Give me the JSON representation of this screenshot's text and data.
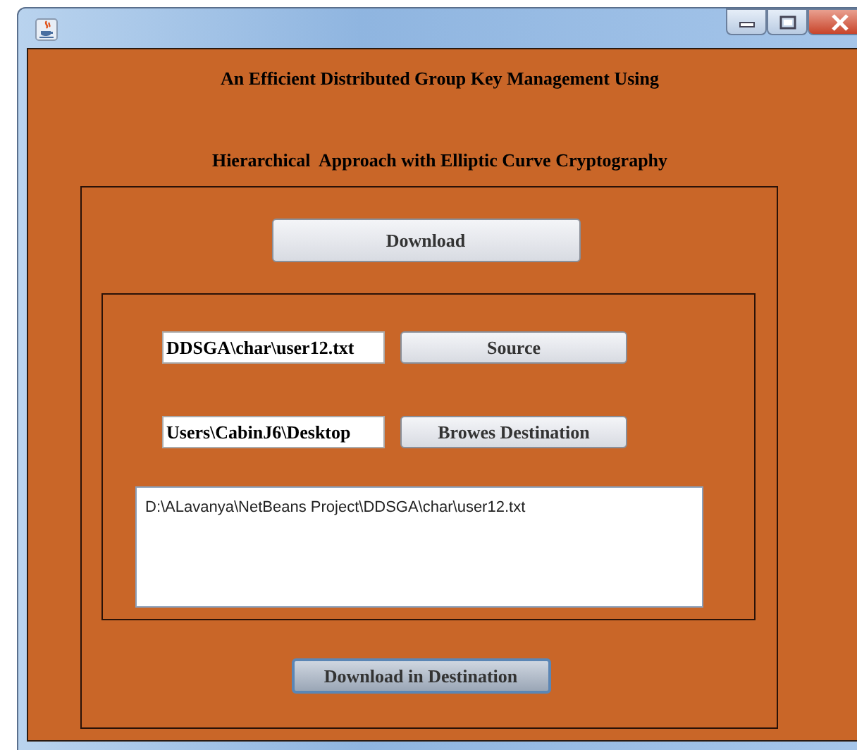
{
  "heading_lines": [
    "An Efficient Distributed Group Key Management Using",
    "Hierarchical  Approach with Elliptic Curve Cryptography"
  ],
  "download_button": {
    "label": "Download",
    "focused": false
  },
  "rows": [
    {
      "value": "DDSGA\\char\\user12.txt",
      "button": "Source"
    },
    {
      "value": "Users\\CabinJ6\\Desktop",
      "button": "Browes Destination"
    }
  ],
  "text_area": {
    "value": "D:\\ALavanya\\NetBeans Project\\DDSGA\\char\\user12.txt"
  },
  "action_button": {
    "label": "Download in Destination",
    "focused": true
  }
}
